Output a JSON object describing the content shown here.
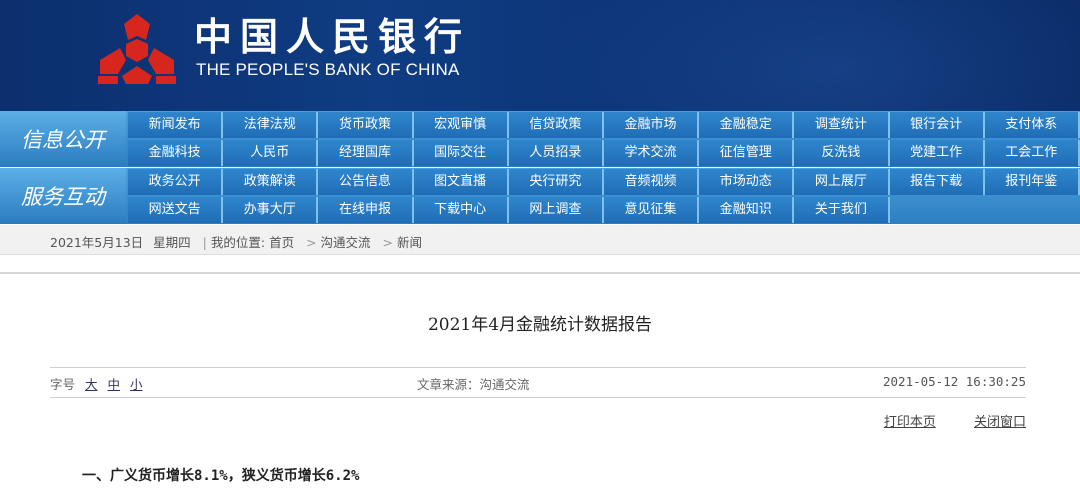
{
  "header": {
    "title_cn": "中国人民银行",
    "title_en": "THE PEOPLE'S BANK OF CHINA",
    "logo_color": "#d7261e"
  },
  "nav": {
    "sections": [
      {
        "label": "信息公开",
        "rows": [
          [
            "新闻发布",
            "法律法规",
            "货币政策",
            "宏观审慎",
            "信贷政策",
            "金融市场",
            "金融稳定",
            "调查统计",
            "银行会计",
            "支付体系"
          ],
          [
            "金融科技",
            "人民币",
            "经理国库",
            "国际交往",
            "人员招录",
            "学术交流",
            "征信管理",
            "反洗钱",
            "党建工作",
            "工会工作"
          ]
        ]
      },
      {
        "label": "服务互动",
        "rows": [
          [
            "政务公开",
            "政策解读",
            "公告信息",
            "图文直播",
            "央行研究",
            "音频视频",
            "市场动态",
            "网上展厅",
            "报告下载",
            "报刊年鉴"
          ],
          [
            "网送文告",
            "办事大厅",
            "在线申报",
            "下载中心",
            "网上调查",
            "意见征集",
            "金融知识",
            "关于我们"
          ]
        ]
      }
    ]
  },
  "breadcrumb": {
    "date": "2021年5月13日",
    "weekday": "星期四",
    "location_label": "我的位置:",
    "items": [
      "首页",
      "沟通交流",
      "新闻"
    ]
  },
  "article": {
    "title": "2021年4月金融统计数据报告",
    "font_size_label": "字号",
    "font_sizes": [
      "大",
      "中",
      "小"
    ],
    "source": "文章来源：沟通交流",
    "datetime": "2021-05-12 16:30:25",
    "print_label": "打印本页",
    "close_label": "关闭窗口",
    "section_heading": "一、广义货币增长8.1%，狭义货币增长6.2%"
  }
}
